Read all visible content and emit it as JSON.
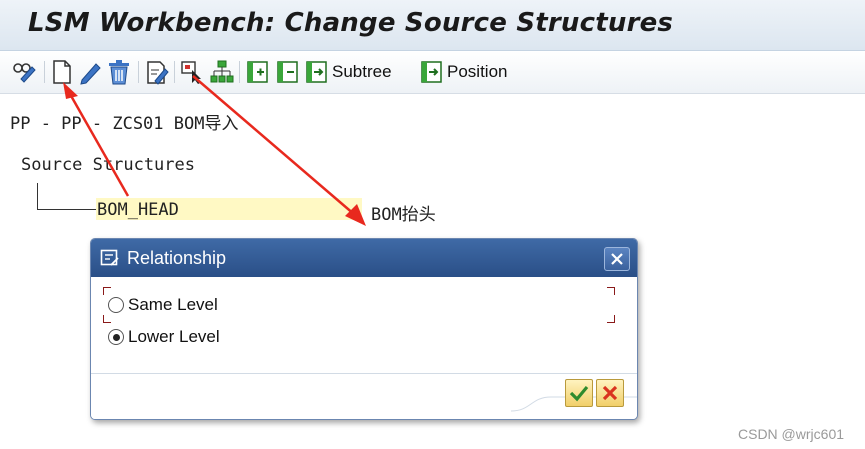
{
  "header": {
    "title": "LSM Workbench: Change Source Structures"
  },
  "toolbar": {
    "subtree_label": "Subtree",
    "position_label": "Position",
    "icons": [
      "display-change-icon",
      "create-icon",
      "edit-icon",
      "delete-icon",
      "edit-text-icon",
      "select-icon",
      "hierarchy-icon",
      "expand-icon",
      "collapse-icon",
      "subtree-icon",
      "position-icon"
    ]
  },
  "main": {
    "path": "PP - PP - ZCS01 BOM导入",
    "section_title": "Source Structures",
    "tree": {
      "node_name": "BOM_HEAD",
      "node_desc": "BOM抬头"
    }
  },
  "dialog": {
    "title": "Relationship",
    "options": [
      {
        "label": "Same Level",
        "selected": false
      },
      {
        "label": "Lower Level",
        "selected": true
      }
    ],
    "confirm_icon": "check-icon",
    "cancel_icon": "cancel-icon"
  },
  "watermark": "CSDN @wrjc601",
  "colors": {
    "annotation_arrow": "#e8291e",
    "dialog_header": "#2f5a94",
    "highlight": "#fff9c4"
  }
}
